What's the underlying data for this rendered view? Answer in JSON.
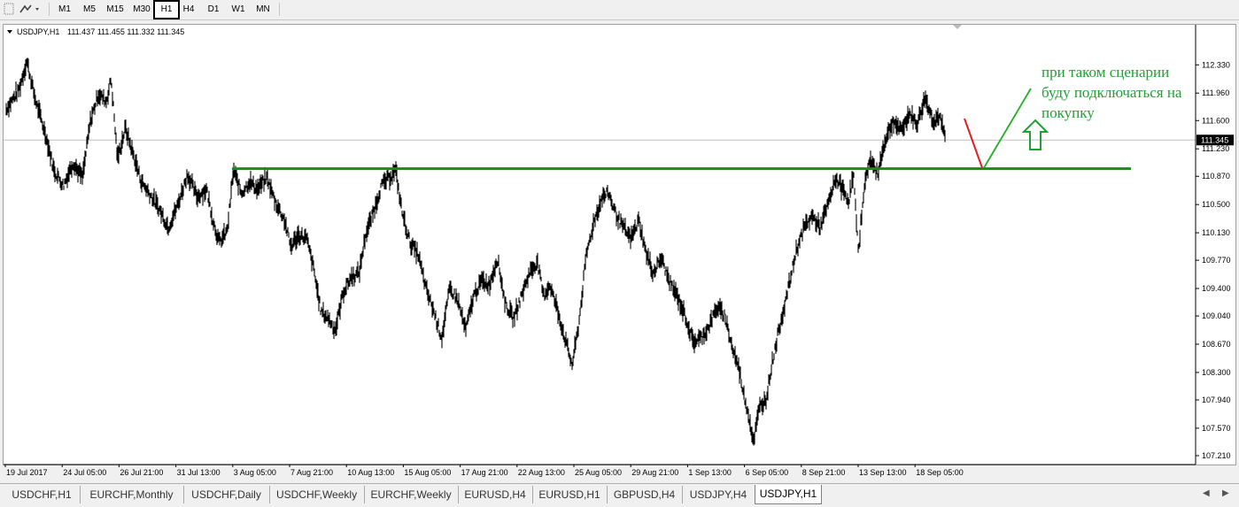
{
  "toolbar": {
    "timeframes": [
      "M1",
      "M5",
      "M15",
      "M30",
      "H1",
      "H4",
      "D1",
      "W1",
      "MN"
    ],
    "active_timeframe": "H1",
    "icons": [
      "crosshair-icon",
      "line-tools-icon"
    ]
  },
  "chart_header": {
    "symbol": "USDJPY,H1",
    "ohlc": "111.437 111.455 111.332 111.345"
  },
  "annotation": {
    "text_lines": [
      "при таком сценарии",
      "буду подключаться на",
      "покупку"
    ],
    "color": "#22a033"
  },
  "colors": {
    "support_line": "#1a8a1a",
    "pullback_line": "#e02020",
    "projection_line": "#22b022",
    "arrow": "#22a033",
    "price_line": "#c0c0c0",
    "current_price_bg": "#000000"
  },
  "chart_data": {
    "type": "line",
    "subtype": "candlestick-bars",
    "symbol": "USDJPY",
    "timeframe": "H1",
    "x_labels": [
      "19 Jul 2017",
      "24 Jul 05:00",
      "26 Jul 21:00",
      "31 Jul 13:00",
      "3 Aug 05:00",
      "7 Aug 21:00",
      "10 Aug 13:00",
      "15 Aug 05:00",
      "17 Aug 21:00",
      "22 Aug 13:00",
      "25 Aug 05:00",
      "29 Aug 21:00",
      "1 Sep 13:00",
      "6 Sep 05:00",
      "8 Sep 21:00",
      "13 Sep 13:00",
      "18 Sep 05:00"
    ],
    "y_ticks": [
      "112.330",
      "111.960",
      "111.600",
      "111.230",
      "110.870",
      "110.500",
      "110.130",
      "109.770",
      "109.400",
      "109.040",
      "108.670",
      "108.300",
      "107.940",
      "107.570",
      "107.210"
    ],
    "ylim": [
      107.14,
      112.6
    ],
    "current_price": "111.345",
    "support_level": 110.97,
    "price_path": [
      [
        0,
        111.75
      ],
      [
        0.8,
        112.0
      ],
      [
        1.3,
        112.38
      ],
      [
        1.8,
        111.9
      ],
      [
        2.5,
        111.4
      ],
      [
        3.0,
        110.95
      ],
      [
        3.6,
        110.75
      ],
      [
        4.2,
        111.05
      ],
      [
        4.8,
        110.85
      ],
      [
        5.3,
        111.6
      ],
      [
        5.8,
        111.95
      ],
      [
        6.3,
        111.85
      ],
      [
        6.6,
        112.15
      ],
      [
        7.0,
        111.1
      ],
      [
        7.5,
        111.5
      ],
      [
        8.0,
        111.15
      ],
      [
        8.5,
        110.8
      ],
      [
        9.0,
        110.65
      ],
      [
        9.6,
        110.45
      ],
      [
        10.2,
        110.2
      ],
      [
        10.8,
        110.5
      ],
      [
        11.4,
        110.9
      ],
      [
        12.0,
        110.6
      ],
      [
        12.6,
        110.7
      ],
      [
        13.0,
        110.3
      ],
      [
        13.4,
        110.0
      ],
      [
        13.9,
        110.15
      ],
      [
        14.3,
        110.95
      ],
      [
        14.8,
        110.65
      ],
      [
        15.3,
        110.8
      ],
      [
        15.8,
        110.7
      ],
      [
        16.4,
        110.85
      ],
      [
        16.9,
        110.55
      ],
      [
        17.5,
        110.3
      ],
      [
        17.9,
        109.95
      ],
      [
        18.4,
        110.1
      ],
      [
        18.9,
        110.05
      ],
      [
        19.3,
        109.7
      ],
      [
        19.8,
        109.1
      ],
      [
        20.3,
        109.0
      ],
      [
        20.7,
        108.85
      ],
      [
        21.2,
        109.35
      ],
      [
        21.7,
        109.55
      ],
      [
        22.2,
        109.6
      ],
      [
        22.6,
        110.1
      ],
      [
        23.1,
        110.4
      ],
      [
        23.6,
        110.75
      ],
      [
        24.1,
        110.85
      ],
      [
        24.5,
        110.95
      ],
      [
        24.9,
        110.4
      ],
      [
        25.4,
        110.0
      ],
      [
        25.9,
        109.85
      ],
      [
        26.4,
        109.4
      ],
      [
        26.9,
        109.1
      ],
      [
        27.4,
        108.75
      ],
      [
        27.9,
        109.4
      ],
      [
        28.4,
        109.25
      ],
      [
        28.9,
        108.85
      ],
      [
        29.4,
        109.3
      ],
      [
        29.9,
        109.5
      ],
      [
        30.4,
        109.45
      ],
      [
        30.9,
        109.8
      ],
      [
        31.4,
        109.2
      ],
      [
        31.9,
        109.0
      ],
      [
        32.4,
        109.3
      ],
      [
        32.9,
        109.6
      ],
      [
        33.4,
        109.75
      ],
      [
        33.8,
        109.3
      ],
      [
        34.2,
        109.45
      ],
      [
        34.7,
        109.1
      ],
      [
        35.2,
        108.7
      ],
      [
        35.6,
        108.4
      ],
      [
        36.0,
        108.9
      ],
      [
        36.5,
        109.85
      ],
      [
        37.0,
        110.3
      ],
      [
        37.5,
        110.6
      ],
      [
        37.9,
        110.65
      ],
      [
        38.3,
        110.4
      ],
      [
        38.8,
        110.2
      ],
      [
        39.3,
        110.05
      ],
      [
        39.8,
        110.3
      ],
      [
        40.2,
        109.9
      ],
      [
        40.7,
        109.6
      ],
      [
        41.2,
        109.8
      ],
      [
        41.7,
        109.5
      ],
      [
        42.2,
        109.3
      ],
      [
        42.7,
        109.05
      ],
      [
        43.2,
        108.7
      ],
      [
        43.7,
        108.75
      ],
      [
        44.2,
        108.9
      ],
      [
        44.7,
        109.15
      ],
      [
        45.2,
        109.05
      ],
      [
        45.7,
        108.6
      ],
      [
        46.1,
        108.35
      ],
      [
        46.4,
        108.0
      ],
      [
        46.7,
        107.75
      ],
      [
        47.0,
        107.4
      ],
      [
        47.4,
        107.85
      ],
      [
        47.8,
        107.95
      ],
      [
        48.2,
        108.45
      ],
      [
        48.7,
        108.95
      ],
      [
        49.2,
        109.4
      ],
      [
        49.7,
        109.9
      ],
      [
        50.2,
        110.2
      ],
      [
        50.7,
        110.35
      ],
      [
        51.2,
        110.2
      ],
      [
        51.7,
        110.5
      ],
      [
        52.2,
        110.85
      ],
      [
        52.6,
        110.7
      ],
      [
        53.0,
        110.55
      ],
      [
        53.3,
        110.9
      ],
      [
        53.6,
        109.85
      ],
      [
        53.9,
        110.6
      ],
      [
        54.3,
        111.1
      ],
      [
        54.8,
        110.9
      ],
      [
        55.3,
        111.35
      ],
      [
        55.8,
        111.6
      ],
      [
        56.3,
        111.45
      ],
      [
        56.8,
        111.7
      ],
      [
        57.3,
        111.55
      ],
      [
        57.8,
        111.9
      ],
      [
        58.3,
        111.6
      ],
      [
        58.7,
        111.65
      ],
      [
        59.1,
        111.35
      ]
    ]
  }
}
